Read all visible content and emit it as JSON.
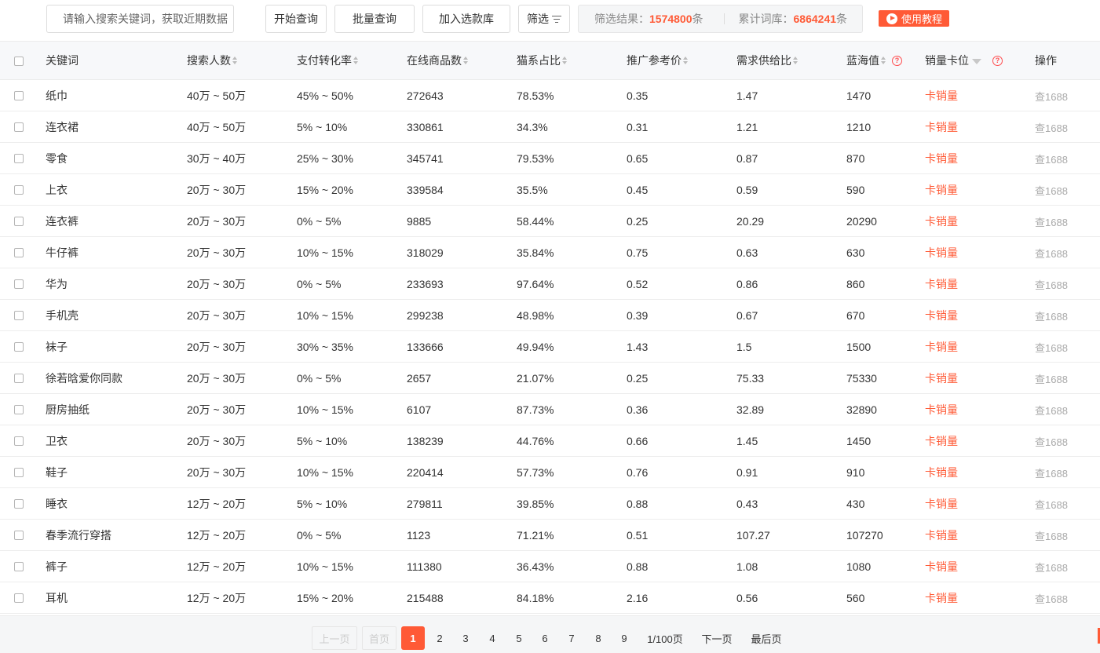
{
  "toolbar": {
    "search_placeholder": "请输入搜索关键词，获取近期数据",
    "start_query": "开始查询",
    "batch_query": "批量查询",
    "add_library": "加入选款库",
    "filter": "筛选",
    "filter_result_label": "筛选结果：",
    "filter_result_value": "1574800",
    "filter_result_unit": "条",
    "total_label": "累计词库：",
    "total_value": "6864241",
    "total_unit": "条",
    "tutorial": "使用教程"
  },
  "columns": {
    "keyword": "关键词",
    "search_users": "搜索人数",
    "conversion": "支付转化率",
    "online_goods": "在线商品数",
    "tmall_ratio": "猫系占比",
    "promo_price": "推广参考价",
    "supply_ratio": "需求供给比",
    "blue_ocean": "蓝海值",
    "sales_slot": "销量卡位",
    "operation": "操作"
  },
  "rows": [
    {
      "keyword": "纸巾",
      "search_users": "40万 ~ 50万",
      "conversion": "45% ~ 50%",
      "online_goods": "272643",
      "tmall_ratio": "78.53%",
      "promo_price": "0.35",
      "supply_ratio": "1.47",
      "blue_ocean": "1470",
      "sales_slot": "卡销量",
      "operation": "查1688"
    },
    {
      "keyword": "连衣裙",
      "search_users": "40万 ~ 50万",
      "conversion": "5% ~ 10%",
      "online_goods": "330861",
      "tmall_ratio": "34.3%",
      "promo_price": "0.31",
      "supply_ratio": "1.21",
      "blue_ocean": "1210",
      "sales_slot": "卡销量",
      "operation": "查1688"
    },
    {
      "keyword": "零食",
      "search_users": "30万 ~ 40万",
      "conversion": "25% ~ 30%",
      "online_goods": "345741",
      "tmall_ratio": "79.53%",
      "promo_price": "0.65",
      "supply_ratio": "0.87",
      "blue_ocean": "870",
      "sales_slot": "卡销量",
      "operation": "查1688"
    },
    {
      "keyword": "上衣",
      "search_users": "20万 ~ 30万",
      "conversion": "15% ~ 20%",
      "online_goods": "339584",
      "tmall_ratio": "35.5%",
      "promo_price": "0.45",
      "supply_ratio": "0.59",
      "blue_ocean": "590",
      "sales_slot": "卡销量",
      "operation": "查1688"
    },
    {
      "keyword": "连衣裤",
      "search_users": "20万 ~ 30万",
      "conversion": "0% ~ 5%",
      "online_goods": "9885",
      "tmall_ratio": "58.44%",
      "promo_price": "0.25",
      "supply_ratio": "20.29",
      "blue_ocean": "20290",
      "sales_slot": "卡销量",
      "operation": "查1688"
    },
    {
      "keyword": "牛仔裤",
      "search_users": "20万 ~ 30万",
      "conversion": "10% ~ 15%",
      "online_goods": "318029",
      "tmall_ratio": "35.84%",
      "promo_price": "0.75",
      "supply_ratio": "0.63",
      "blue_ocean": "630",
      "sales_slot": "卡销量",
      "operation": "查1688"
    },
    {
      "keyword": "华为",
      "search_users": "20万 ~ 30万",
      "conversion": "0% ~ 5%",
      "online_goods": "233693",
      "tmall_ratio": "97.64%",
      "promo_price": "0.52",
      "supply_ratio": "0.86",
      "blue_ocean": "860",
      "sales_slot": "卡销量",
      "operation": "查1688"
    },
    {
      "keyword": "手机壳",
      "search_users": "20万 ~ 30万",
      "conversion": "10% ~ 15%",
      "online_goods": "299238",
      "tmall_ratio": "48.98%",
      "promo_price": "0.39",
      "supply_ratio": "0.67",
      "blue_ocean": "670",
      "sales_slot": "卡销量",
      "operation": "查1688"
    },
    {
      "keyword": "袜子",
      "search_users": "20万 ~ 30万",
      "conversion": "30% ~ 35%",
      "online_goods": "133666",
      "tmall_ratio": "49.94%",
      "promo_price": "1.43",
      "supply_ratio": "1.5",
      "blue_ocean": "1500",
      "sales_slot": "卡销量",
      "operation": "查1688"
    },
    {
      "keyword": "徐若晗爱你同款",
      "search_users": "20万 ~ 30万",
      "conversion": "0% ~ 5%",
      "online_goods": "2657",
      "tmall_ratio": "21.07%",
      "promo_price": "0.25",
      "supply_ratio": "75.33",
      "blue_ocean": "75330",
      "sales_slot": "卡销量",
      "operation": "查1688"
    },
    {
      "keyword": "厨房抽纸",
      "search_users": "20万 ~ 30万",
      "conversion": "10% ~ 15%",
      "online_goods": "6107",
      "tmall_ratio": "87.73%",
      "promo_price": "0.36",
      "supply_ratio": "32.89",
      "blue_ocean": "32890",
      "sales_slot": "卡销量",
      "operation": "查1688"
    },
    {
      "keyword": "卫衣",
      "search_users": "20万 ~ 30万",
      "conversion": "5% ~ 10%",
      "online_goods": "138239",
      "tmall_ratio": "44.76%",
      "promo_price": "0.66",
      "supply_ratio": "1.45",
      "blue_ocean": "1450",
      "sales_slot": "卡销量",
      "operation": "查1688"
    },
    {
      "keyword": "鞋子",
      "search_users": "20万 ~ 30万",
      "conversion": "10% ~ 15%",
      "online_goods": "220414",
      "tmall_ratio": "57.73%",
      "promo_price": "0.76",
      "supply_ratio": "0.91",
      "blue_ocean": "910",
      "sales_slot": "卡销量",
      "operation": "查1688"
    },
    {
      "keyword": "睡衣",
      "search_users": "12万 ~ 20万",
      "conversion": "5% ~ 10%",
      "online_goods": "279811",
      "tmall_ratio": "39.85%",
      "promo_price": "0.88",
      "supply_ratio": "0.43",
      "blue_ocean": "430",
      "sales_slot": "卡销量",
      "operation": "查1688"
    },
    {
      "keyword": "春季流行穿搭",
      "search_users": "12万 ~ 20万",
      "conversion": "0% ~ 5%",
      "online_goods": "1123",
      "tmall_ratio": "71.21%",
      "promo_price": "0.51",
      "supply_ratio": "107.27",
      "blue_ocean": "107270",
      "sales_slot": "卡销量",
      "operation": "查1688"
    },
    {
      "keyword": "裤子",
      "search_users": "12万 ~ 20万",
      "conversion": "10% ~ 15%",
      "online_goods": "111380",
      "tmall_ratio": "36.43%",
      "promo_price": "0.88",
      "supply_ratio": "1.08",
      "blue_ocean": "1080",
      "sales_slot": "卡销量",
      "operation": "查1688"
    },
    {
      "keyword": "耳机",
      "search_users": "12万 ~ 20万",
      "conversion": "15% ~ 20%",
      "online_goods": "215488",
      "tmall_ratio": "84.18%",
      "promo_price": "2.16",
      "supply_ratio": "0.56",
      "blue_ocean": "560",
      "sales_slot": "卡销量",
      "operation": "查1688"
    }
  ],
  "pagination": {
    "prev": "上一页",
    "first": "首页",
    "pages": [
      "1",
      "2",
      "3",
      "4",
      "5",
      "6",
      "7",
      "8",
      "9"
    ],
    "current": "1",
    "page_info": "1/100页",
    "next": "下一页",
    "last": "最后页"
  },
  "colors": {
    "accent": "#ff5a36",
    "header_bg": "#f7f8fa"
  }
}
